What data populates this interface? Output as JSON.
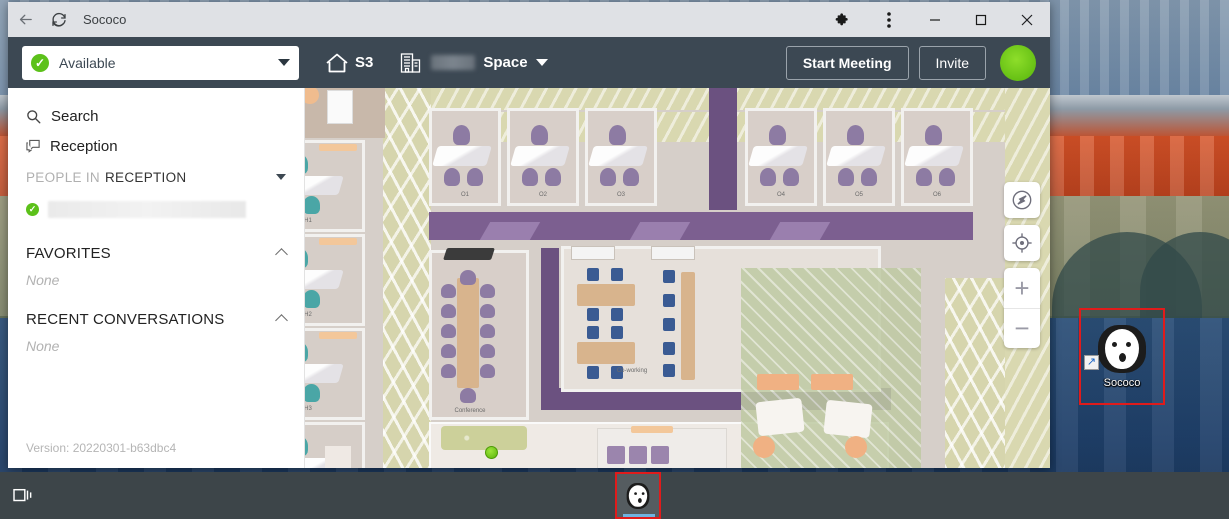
{
  "window": {
    "title": "Sococo",
    "titlebar_icons": {
      "back": "back-arrow-icon",
      "reload": "reload-icon",
      "extensions": "puzzle-piece-icon",
      "menu": "three-dot-menu-icon",
      "minimize": "minimize-icon",
      "maximize": "maximize-icon",
      "close": "close-icon"
    }
  },
  "header": {
    "status": {
      "label": "Available",
      "icon": "green-check-icon",
      "caret": "chevron-down-icon"
    },
    "home": {
      "label": "S3",
      "icon": "home-icon"
    },
    "space": {
      "name_redacted": true,
      "label": "Space",
      "icon": "building-icon",
      "caret": "chevron-down-icon"
    },
    "start_meeting_label": "Start Meeting",
    "invite_label": "Invite",
    "avatar": "user-avatar",
    "accent_color": "#3c4853",
    "available_color": "#5cc11a"
  },
  "sidebar": {
    "search_label": "Search",
    "reception_label": "Reception",
    "people_section": {
      "prefix": "PEOPLE IN",
      "room": "RECEPTION",
      "person_redacted": true,
      "person_status": "available"
    },
    "favorites": {
      "title": "FAVORITES",
      "empty": "None"
    },
    "recent_conversations": {
      "title": "RECENT CONVERSATIONS",
      "empty": "None"
    },
    "version": "Version: 20220301-b63dbc4"
  },
  "map": {
    "rooms": [
      {
        "label": "O1"
      },
      {
        "label": "O2"
      },
      {
        "label": "O3"
      },
      {
        "label": "O4"
      },
      {
        "label": "O5"
      },
      {
        "label": "O6"
      },
      {
        "label": "H1"
      },
      {
        "label": "H2"
      },
      {
        "label": "H3"
      },
      {
        "label": "Conference"
      },
      {
        "label": "Co-working"
      }
    ],
    "controls": {
      "navigate": "compass-arrow-icon",
      "locate": "crosshair-target-icon",
      "zoom_in": "+",
      "zoom_out": "−"
    }
  },
  "desktop": {
    "shortcut": {
      "label": "Sococo",
      "icon": "sococo-face-icon",
      "badge": "shortcut-arrow-icon",
      "highlighted": true
    },
    "highlight_color": "#e01b1b"
  },
  "taskbar": {
    "taskview": "task-view-icon",
    "sococo": {
      "label": "Sococo",
      "icon": "sococo-face-icon",
      "active": true,
      "highlighted": true
    }
  }
}
